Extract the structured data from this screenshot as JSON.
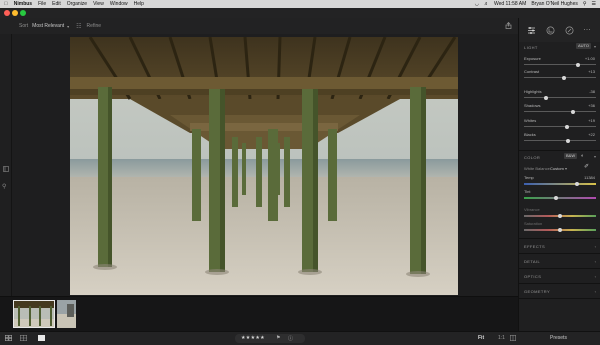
{
  "menubar": {
    "app_name": "Nimbus",
    "items": [
      "File",
      "Edit",
      "Organize",
      "View",
      "Window",
      "Help"
    ],
    "clock": "Wed 11:58 AM",
    "user": "Bryan O'Neil Hughes"
  },
  "toolbar": {
    "sort_label": "Sort",
    "sort_value": "Most Relevant",
    "refine_label": "Refine"
  },
  "panel": {
    "light": {
      "title": "LIGHT",
      "auto_label": "AUTO",
      "sliders": [
        {
          "label": "Exposure",
          "value": "+1.00",
          "pos": 0.75
        },
        {
          "label": "Contrast",
          "value": "+13",
          "pos": 0.56
        },
        {
          "label": "Highlights",
          "value": "-38",
          "pos": 0.31
        },
        {
          "label": "Shadows",
          "value": "+36",
          "pos": 0.68
        },
        {
          "label": "Whites",
          "value": "+19",
          "pos": 0.6
        },
        {
          "label": "Blacks",
          "value": "+22",
          "pos": 0.61
        }
      ]
    },
    "color": {
      "title": "COLOR",
      "bw_label": "B&W",
      "white_balance_label": "White Balance",
      "white_balance_value": "Custom",
      "sliders": [
        {
          "label": "Temp",
          "value": "11384",
          "pos": 0.74
        },
        {
          "label": "Tint",
          "value": "",
          "pos": 0.45
        },
        {
          "label": "Vibrance",
          "value": "",
          "pos": 0.5
        },
        {
          "label": "Saturation",
          "value": "",
          "pos": 0.5
        }
      ]
    },
    "collapsed_sections": [
      "EFFECTS",
      "DETAIL",
      "OPTICS",
      "GEOMETRY"
    ]
  },
  "bottombar": {
    "rating": "★★★★★",
    "fit_label": "Fit",
    "zoom_1": "1:1",
    "presets_label": "Presets"
  },
  "colors": {
    "accent": "#2a7fd4",
    "panel_bg": "#1f1f20",
    "canvas_bg": "#1e1e1f"
  }
}
